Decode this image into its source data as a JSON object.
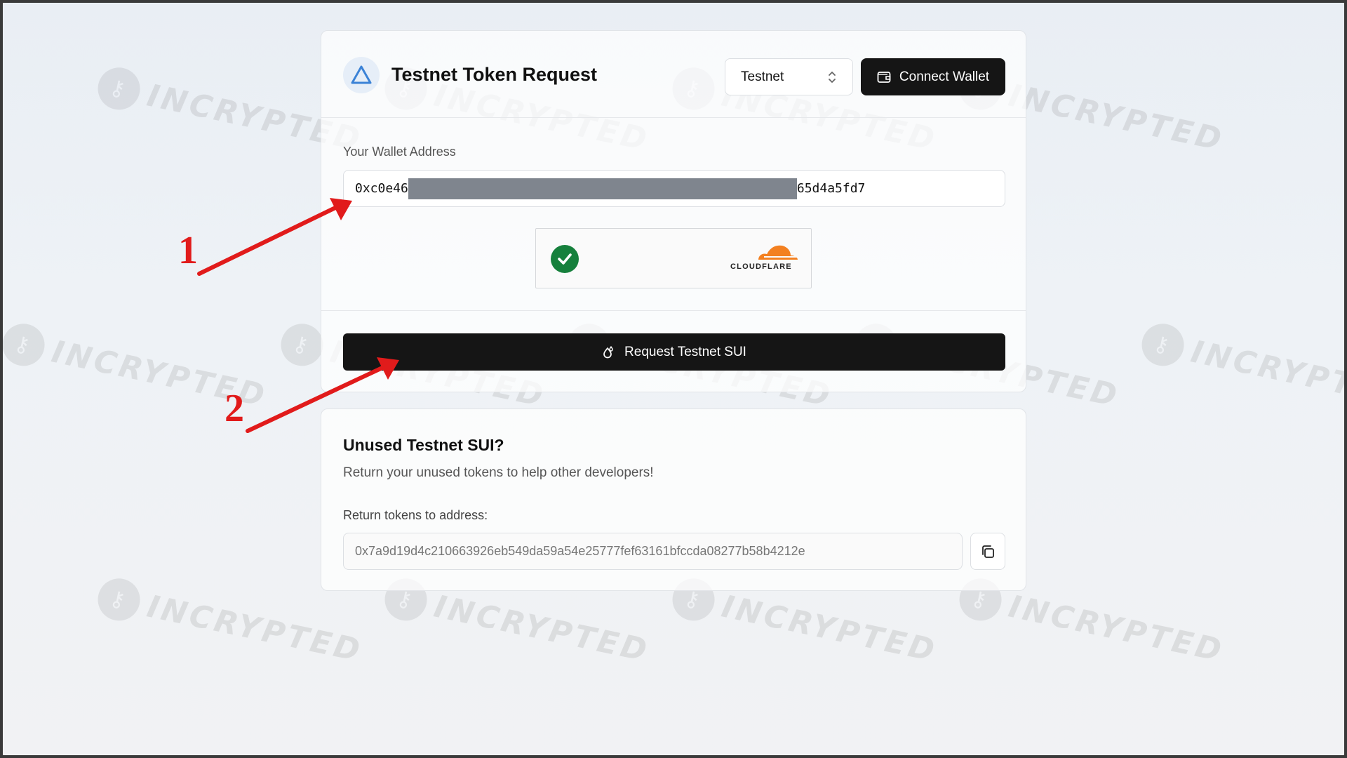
{
  "header": {
    "title": "Testnet Token Request",
    "network_value": "Testnet",
    "connect_label": "Connect Wallet"
  },
  "wallet": {
    "label": "Your Wallet Address",
    "address_start": "0xc0e46",
    "address_end": "65d4a5fd7"
  },
  "captcha": {
    "provider": "CLOUDFLARE",
    "status": "verified"
  },
  "request": {
    "label": "Request Testnet SUI"
  },
  "unused": {
    "title": "Unused Testnet SUI?",
    "description": "Return your unused tokens to help other developers!",
    "return_label": "Return tokens to address:",
    "return_address": "0x7a9d19d4c210663926eb549da59a54e25777fef63161bfccda08277b58b4212e"
  },
  "annotations": {
    "step1": "1",
    "step2": "2"
  },
  "watermark": {
    "text": "INCRYPTED"
  },
  "colors": {
    "primary_button": "#151515",
    "annotation": "#e11b1b",
    "check": "#16803c",
    "cloudflare": "#f38020"
  },
  "icons": [
    "sui-triangle-icon",
    "chevron-updown-icon",
    "wallet-icon",
    "check-icon",
    "cloudflare-logo",
    "droplet-icon",
    "copy-icon"
  ]
}
